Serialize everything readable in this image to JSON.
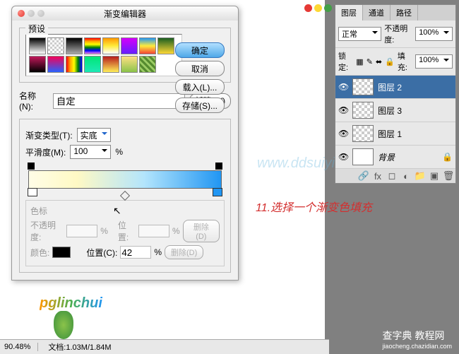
{
  "dialog": {
    "title": "渐变编辑器",
    "preset_label": "预设",
    "buttons": {
      "ok": "确定",
      "cancel": "取消",
      "load": "载入(L)...",
      "save": "存储(S)..."
    },
    "name_label": "名称(N):",
    "name_value": "自定",
    "new_btn": "新建(W)",
    "type_label": "渐变类型(T):",
    "type_value": "实底",
    "smooth_label": "平滑度(M):",
    "smooth_value": "100",
    "smooth_unit": "%",
    "stops_label": "色标",
    "opacity_label": "不透明度:",
    "opacity_unit": "%",
    "pos_label": "位置:",
    "pos_unit": "%",
    "color_label": "颜色:",
    "pos2_label": "位置(C):",
    "pos2_value": "42",
    "pos2_unit": "%",
    "delete1": "删除(D)",
    "delete2": "删除(D)"
  },
  "annotation": "11.选择一个渐变色填充",
  "watermark": "www.ddsuiyi.com",
  "layers": {
    "tabs": {
      "layers": "图层",
      "channels": "通道",
      "paths": "路径"
    },
    "blend_mode": "正常",
    "opacity_label": "不透明度:",
    "opacity_value": "100%",
    "lock_label": "锁定:",
    "fill_label": "填充:",
    "fill_value": "100%",
    "items": [
      {
        "name": "图层 2",
        "active": true,
        "checker": true
      },
      {
        "name": "图层 3",
        "active": false,
        "checker": true
      },
      {
        "name": "图层 1",
        "active": false,
        "checker": true
      },
      {
        "name": "背景",
        "active": false,
        "checker": false,
        "italic": true
      }
    ]
  },
  "status": {
    "zoom": "90.48%",
    "doc_label": "文档:",
    "doc_value": "1.03M/1.84M"
  },
  "site_wm": {
    "line1": "查字典 教程网",
    "line2": "jiaocheng.chazidian.com"
  }
}
